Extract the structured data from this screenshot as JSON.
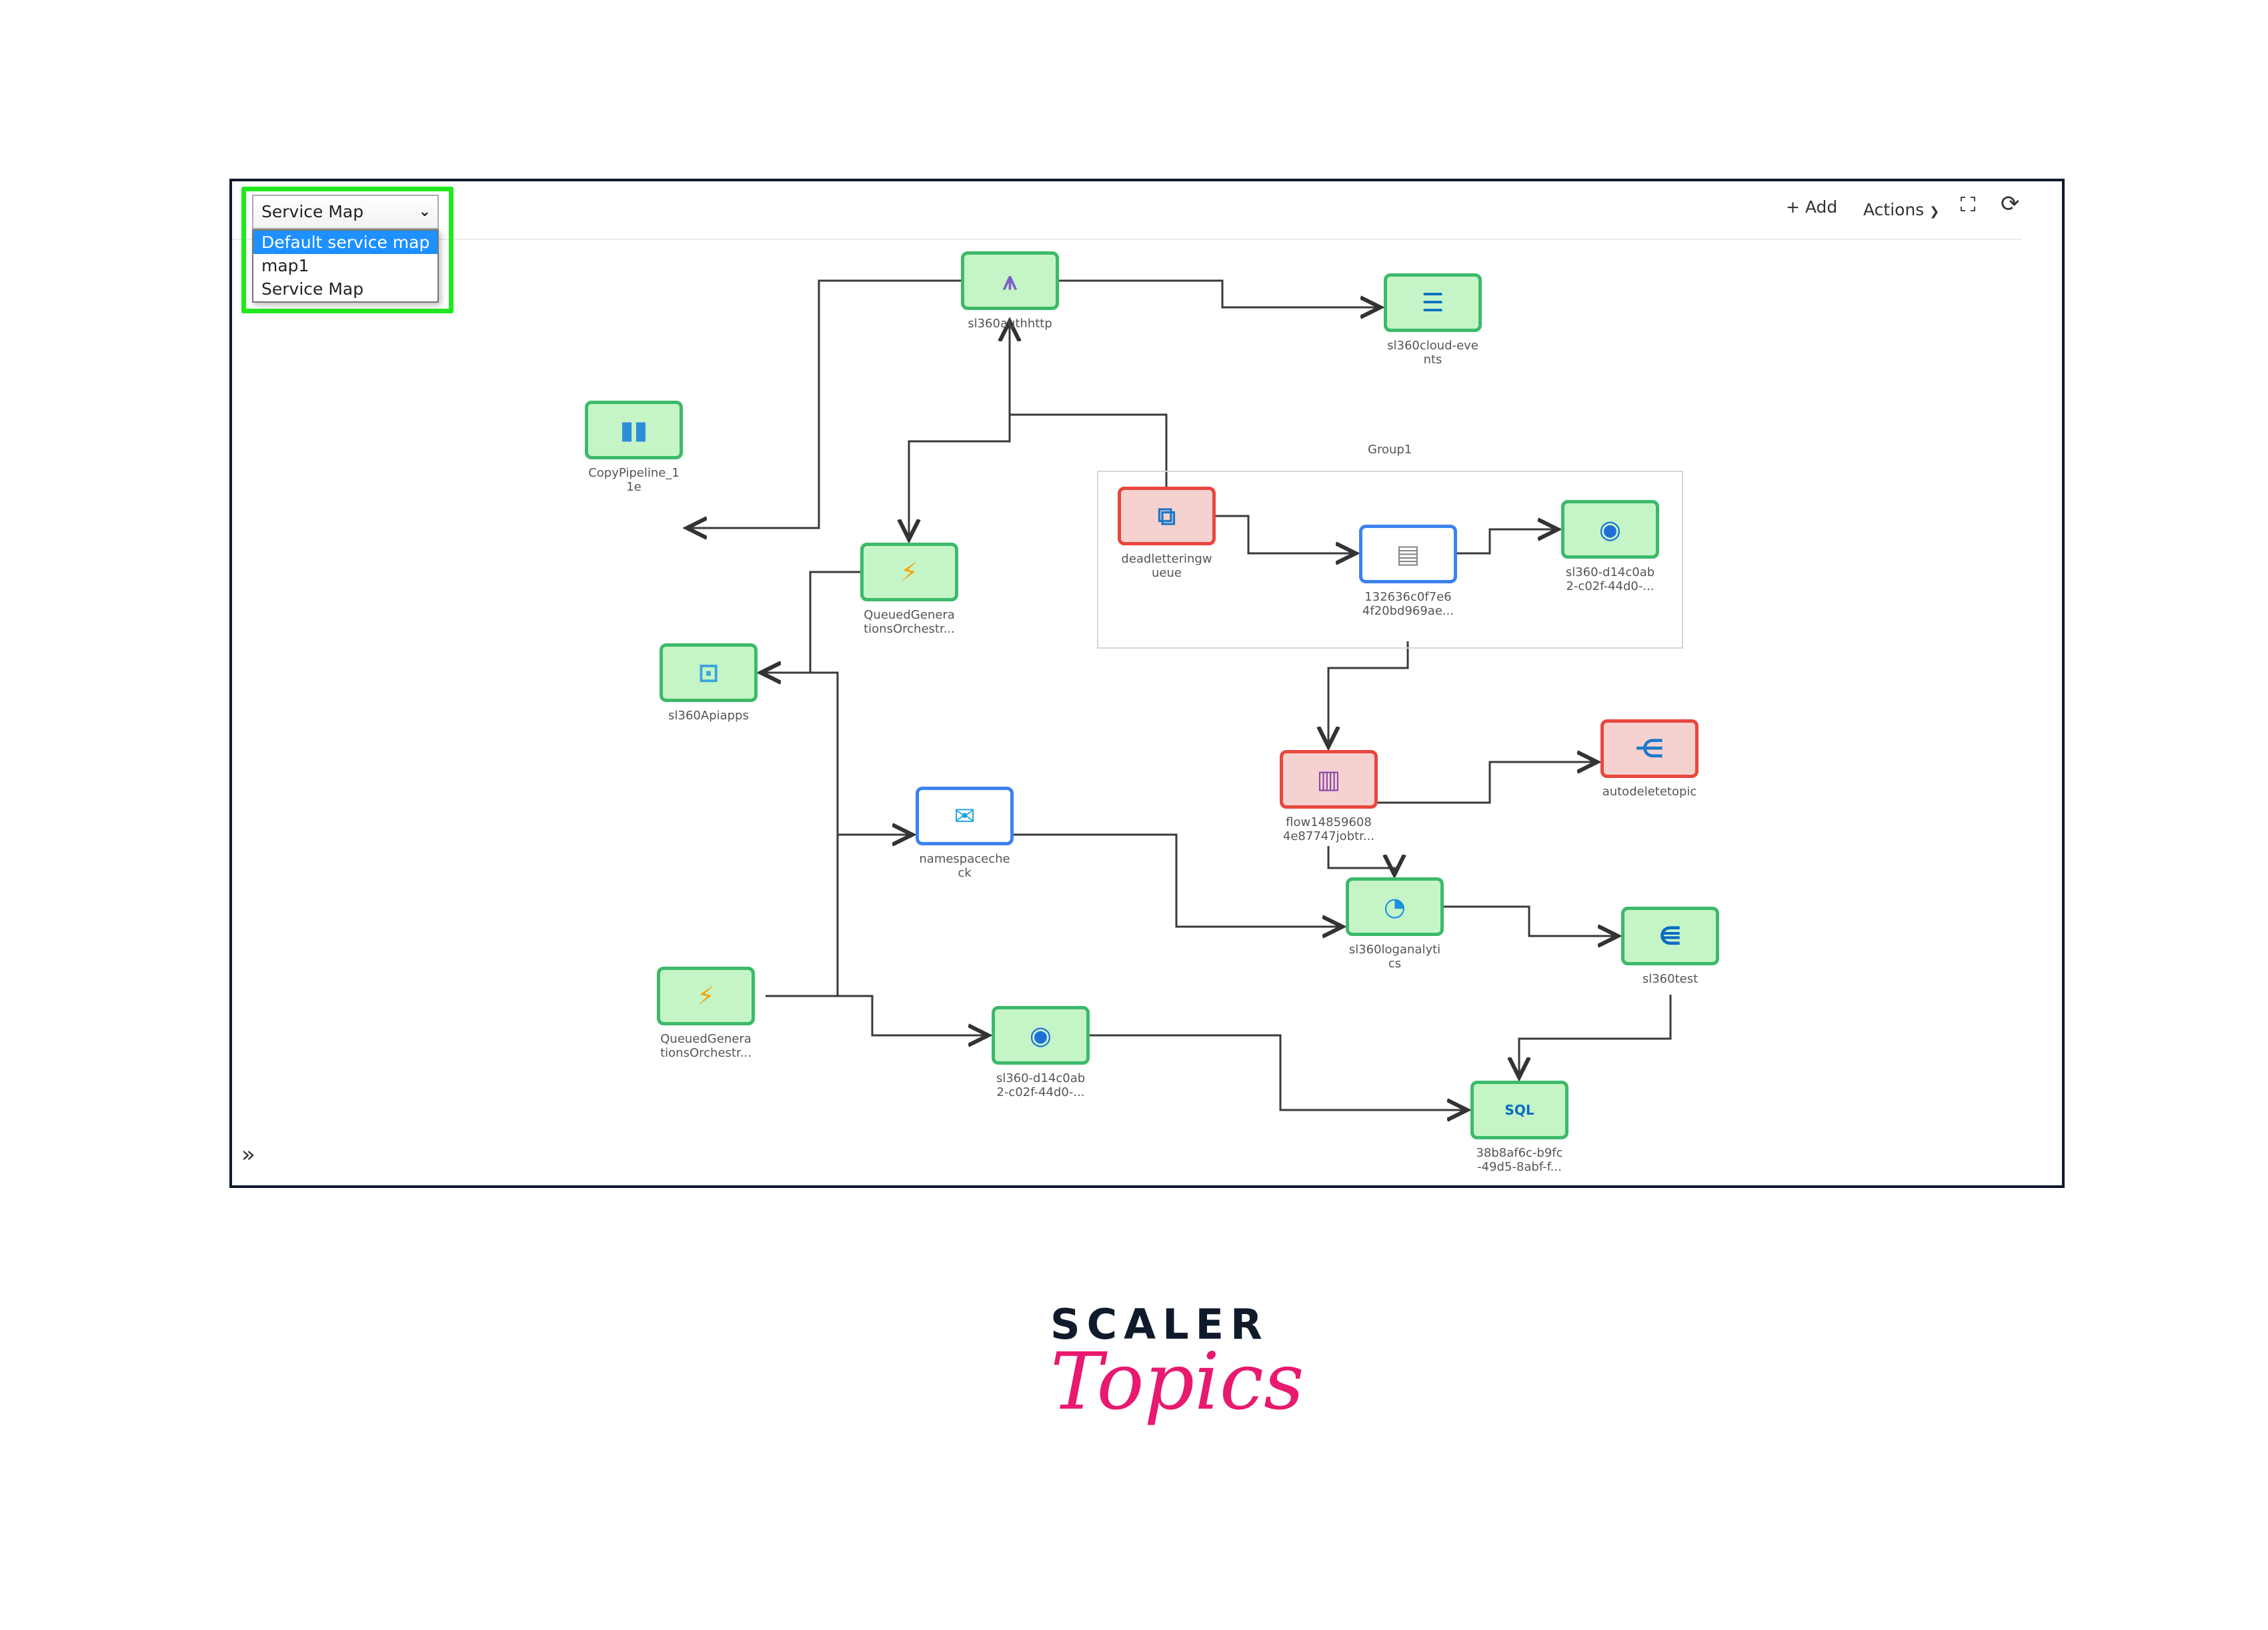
{
  "map_selector": {
    "selected": "Service Map",
    "options": [
      "Default service map",
      "map1",
      "Service Map"
    ],
    "highlighted_option": "Default service map"
  },
  "toolbar": {
    "add_label": "+ Add",
    "actions_label": "Actions",
    "fullscreen_icon": "expand-icon",
    "refresh_icon": "refresh-icon"
  },
  "group": {
    "label": "Group1"
  },
  "nodes": [
    {
      "id": "authhttp",
      "label": "sl360authhttp",
      "status": "healthy",
      "icon": "api-management-icon"
    },
    {
      "id": "cloudevents",
      "label": "sl360cloud-eve\nnts",
      "status": "healthy",
      "icon": "event-grid-icon"
    },
    {
      "id": "copypipeline",
      "label": "CopyPipeline_1\n1e",
      "status": "healthy",
      "icon": "pipeline-icon"
    },
    {
      "id": "queued1",
      "label": "QueuedGenera\ntionsOrchestr...",
      "status": "healthy",
      "icon": "function-app-icon"
    },
    {
      "id": "deadletter",
      "label": "deadletteringw\nueue",
      "status": "error",
      "icon": "service-bus-queue-icon"
    },
    {
      "id": "hash132",
      "label": "132636c0f7e6\n4f20bd969ae...",
      "status": "selected",
      "icon": "storage-icon"
    },
    {
      "id": "d14group",
      "label": "sl360-d14c0ab\n2-c02f-44d0-...",
      "status": "healthy",
      "icon": "cosmos-db-icon"
    },
    {
      "id": "apiapps",
      "label": "sl360Apiapps",
      "status": "healthy",
      "icon": "api-app-icon"
    },
    {
      "id": "flow",
      "label": "flow14859608\n4e87747jobtr...",
      "status": "error",
      "icon": "data-factory-icon"
    },
    {
      "id": "autodelete",
      "label": "autodeletetopic",
      "status": "error",
      "icon": "service-bus-topic-icon"
    },
    {
      "id": "namespace",
      "label": "namespaceche\nck",
      "status": "selected",
      "icon": "service-bus-namespace-icon"
    },
    {
      "id": "loganalytics",
      "label": "sl360loganalyti\ncs",
      "status": "healthy",
      "icon": "log-analytics-icon"
    },
    {
      "id": "test",
      "label": "sl360test",
      "status": "healthy",
      "icon": "event-hub-icon"
    },
    {
      "id": "queued2",
      "label": "QueuedGenera\ntionsOrchestr...",
      "status": "healthy",
      "icon": "function-app-icon"
    },
    {
      "id": "d14bottom",
      "label": "sl360-d14c0ab\n2-c02f-44d0-...",
      "status": "healthy",
      "icon": "cosmos-db-icon"
    },
    {
      "id": "sql",
      "label": "38b8af6c-b9fc\n-49d5-8abf-f...",
      "status": "healthy",
      "icon": "sql-database-icon"
    }
  ],
  "edges": [
    [
      "authhttp",
      "copypipeline"
    ],
    [
      "authhttp",
      "cloudevents"
    ],
    [
      "deadletter",
      "authhttp"
    ],
    [
      "authhttp",
      "queued1"
    ],
    [
      "queued1",
      "apiapps"
    ],
    [
      "deadletter",
      "hash132"
    ],
    [
      "hash132",
      "d14group"
    ],
    [
      "hash132",
      "flow"
    ],
    [
      "flow",
      "autodelete"
    ],
    [
      "flow",
      "loganalytics"
    ],
    [
      "queued2",
      "apiapps"
    ],
    [
      "queued2",
      "namespace"
    ],
    [
      "queued2",
      "d14bottom"
    ],
    [
      "namespace",
      "loganalytics"
    ],
    [
      "loganalytics",
      "test"
    ],
    [
      "test",
      "sql"
    ],
    [
      "d14bottom",
      "sql"
    ]
  ],
  "brand": {
    "line1": "SCALER",
    "line2": "Topics"
  },
  "colors": {
    "healthy_border": "#3cba6a",
    "healthy_fill": "#c5f5c7",
    "error_border": "#e8473e",
    "error_fill": "#f5d2d0",
    "selected_border": "#3b82f0",
    "highlight": "#21e81f",
    "option_selected": "#1e90ff",
    "brand_pink": "#e8196f",
    "brand_navy": "#0f1a2b"
  }
}
